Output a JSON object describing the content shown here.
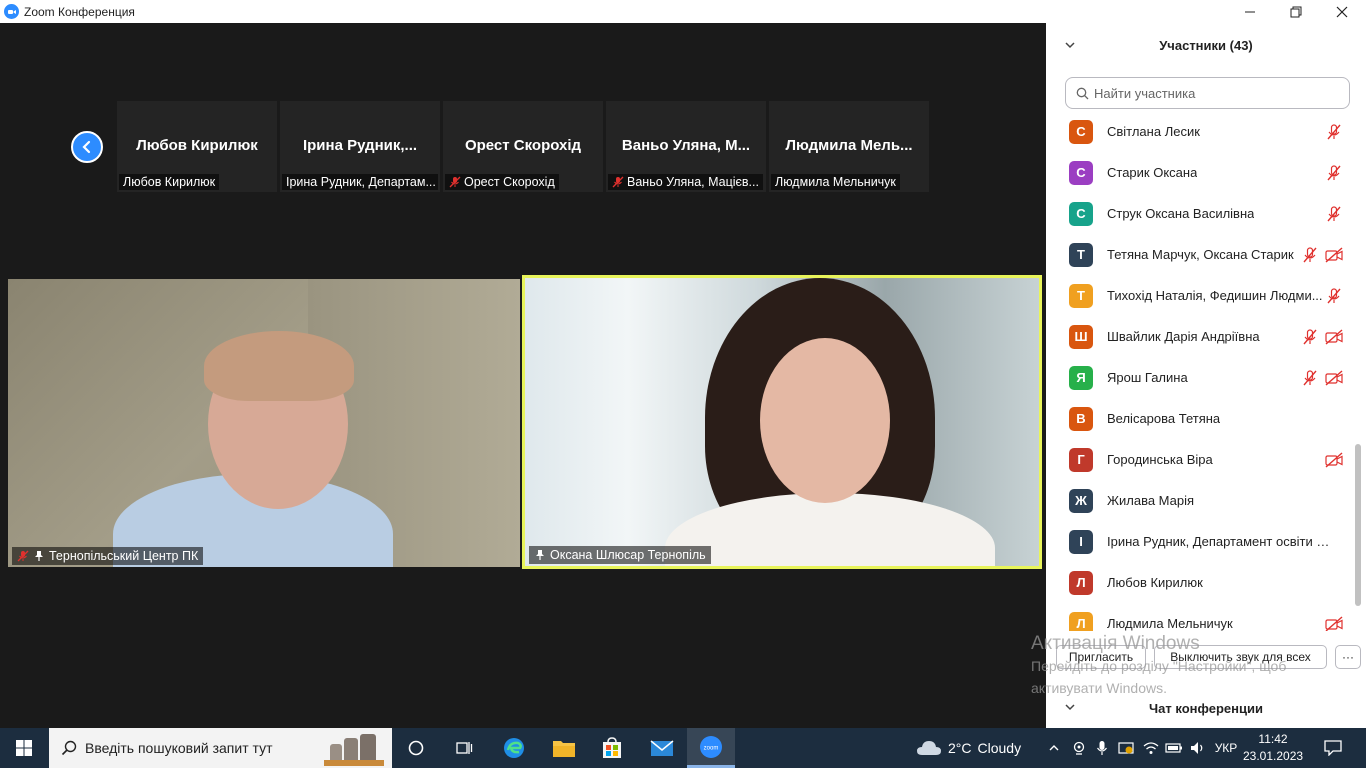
{
  "window": {
    "title": "Zoom Конференция",
    "minimize_icon": "minimize-icon",
    "maximize_icon": "restore-icon",
    "close_icon": "close-icon"
  },
  "thumbnails": [
    {
      "display_name": "Любов Кирилюк",
      "caption": "Любов Кирилюк",
      "muted": false
    },
    {
      "display_name": "Ірина  Рудник,...",
      "caption": "Ірина Рудник, Департам...",
      "muted": false
    },
    {
      "display_name": "Орест Скорохід",
      "caption": "Орест Скорохід",
      "muted": true
    },
    {
      "display_name": "Ваньо  Уляна,  М...",
      "caption": "Ваньо Уляна, Мацієв...",
      "muted": true
    },
    {
      "display_name": "Людмила  Мель...",
      "caption": "Людмила Мельничук",
      "muted": false
    }
  ],
  "videos": [
    {
      "caption": "Тернопільський Центр ПК",
      "muted": true,
      "pinned": true
    },
    {
      "caption": "Оксана Шлюсар Тернопіль",
      "muted": false,
      "pinned": true,
      "active_speaker": true
    }
  ],
  "participants_panel": {
    "title": "Участники (43)",
    "search_placeholder": "Найти участника",
    "participants": [
      {
        "initial": "С",
        "name": "Світлана Лесик",
        "color": "#d9560f",
        "mic_muted": true,
        "video_off": false
      },
      {
        "initial": "С",
        "name": "Старик Оксана",
        "color": "#9b3ec2",
        "mic_muted": true,
        "video_off": false
      },
      {
        "initial": "С",
        "name": "Струк Оксана Василівна",
        "color": "#17a38b",
        "mic_muted": true,
        "video_off": false
      },
      {
        "initial": "Т",
        "name": "Тетяна Марчук, Оксана Старик",
        "color": "#2f4358",
        "mic_muted": true,
        "video_off": true
      },
      {
        "initial": "Т",
        "name": "Тихохід Наталія, Федишин Людми...",
        "color": "#f0a020",
        "mic_muted": true,
        "video_off": false
      },
      {
        "initial": "Ш",
        "name": "Швайлик Дарія Андріївна",
        "color": "#d9560f",
        "mic_muted": true,
        "video_off": true
      },
      {
        "initial": "Я",
        "name": "Ярош Галина",
        "color": "#27b04a",
        "mic_muted": true,
        "video_off": true
      },
      {
        "initial": "В",
        "name": "Велісарова Тетяна",
        "color": "#d9560f",
        "mic_muted": false,
        "video_off": false
      },
      {
        "initial": "Г",
        "name": "Городинська Віра",
        "color": "#c0392b",
        "mic_muted": false,
        "video_off": true
      },
      {
        "initial": "Ж",
        "name": "Жилава Марія",
        "color": "#2f4358",
        "mic_muted": false,
        "video_off": false
      },
      {
        "initial": "І",
        "name": "Ірина Рудник, Департамент освіти і на...",
        "color": "#2f4358",
        "mic_muted": false,
        "video_off": false
      },
      {
        "initial": "Л",
        "name": "Любов Кирилюк",
        "color": "#c0392b",
        "mic_muted": false,
        "video_off": false
      },
      {
        "initial": "Л",
        "name": "Людмила Мельничук",
        "color": "#f0a020",
        "mic_muted": false,
        "video_off": true
      }
    ],
    "invite_label": "Пригласить",
    "mute_all_label": "Выключить звук для всех",
    "more_label": "···",
    "chat_title": "Чат конференции"
  },
  "watermark": {
    "line1": "Активація Windows",
    "line2": "Перейдіть до розділу \"Настройки\", щоб",
    "line3": "активувати Windows."
  },
  "taskbar": {
    "search_placeholder": "Введіть пошуковий запит тут",
    "weather_temp": "2°C",
    "weather_text": "Cloudy",
    "language": "УКР",
    "time": "11:42",
    "date": "23.01.2023"
  }
}
